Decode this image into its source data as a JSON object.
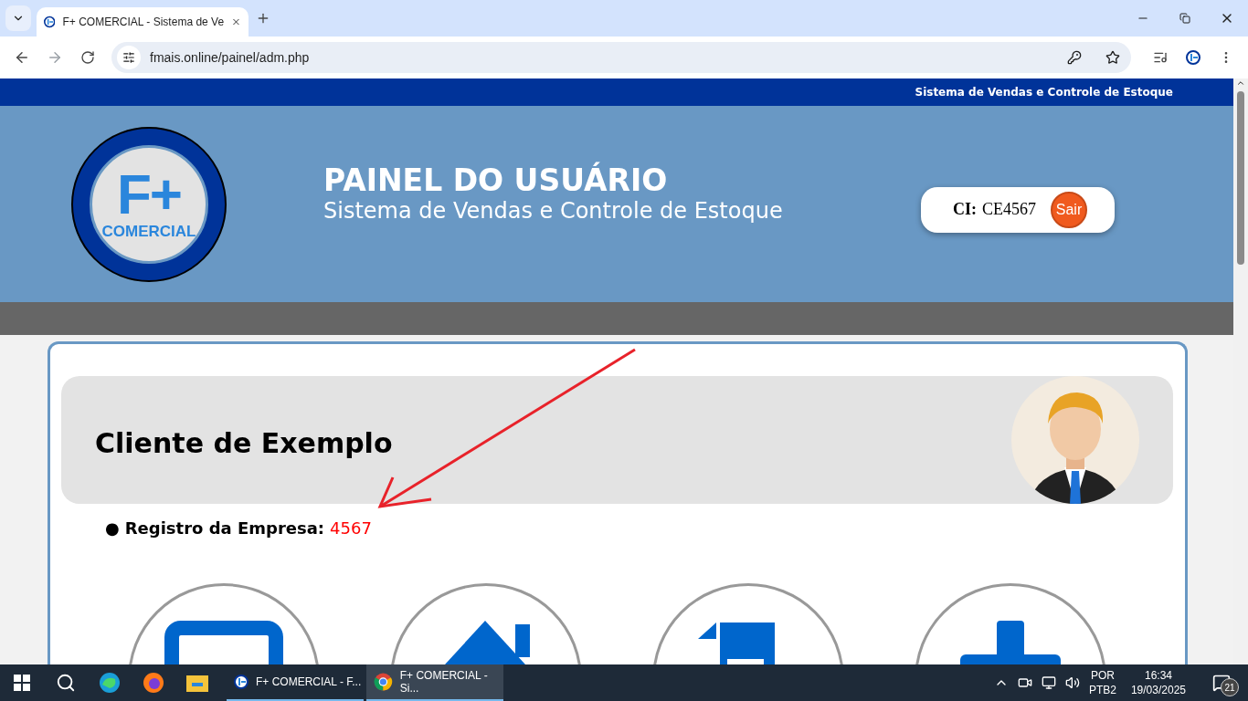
{
  "browser": {
    "tab": {
      "title": "F+ COMERCIAL - Sistema de Ve",
      "selected": true
    },
    "address": "fmais.online/painel/adm.php"
  },
  "page": {
    "top_bar": "Sistema de Vendas e Controle de Estoque",
    "header": {
      "logo": {
        "mark": "F+",
        "name": "COMERCIAL"
      },
      "title": "PAINEL DO USUÁRIO",
      "subtitle": "Sistema de Vendas e Controle de Estoque",
      "ci_label": "CI:",
      "ci_value": "CE4567",
      "logout": "Sair"
    },
    "client": {
      "name": "Cliente de Exemplo",
      "bullet": "●",
      "registration_label": "Registro da Empresa:",
      "registration_value": "4567"
    },
    "menu_tiles": [
      {
        "kind": "monitor"
      },
      {
        "kind": "house"
      },
      {
        "kind": "document"
      },
      {
        "kind": "plus"
      }
    ]
  },
  "taskbar": {
    "apps": [
      {
        "title": "F+ COMERCIAL - F...",
        "kind": "fplus",
        "selected": false
      },
      {
        "title": "F+ COMERCIAL - Si...",
        "kind": "chrome",
        "selected": true
      }
    ],
    "tray": {
      "language": "POR",
      "layout": "PTB2",
      "time": "16:34",
      "date": "19/03/2025",
      "notifications": "21"
    }
  }
}
